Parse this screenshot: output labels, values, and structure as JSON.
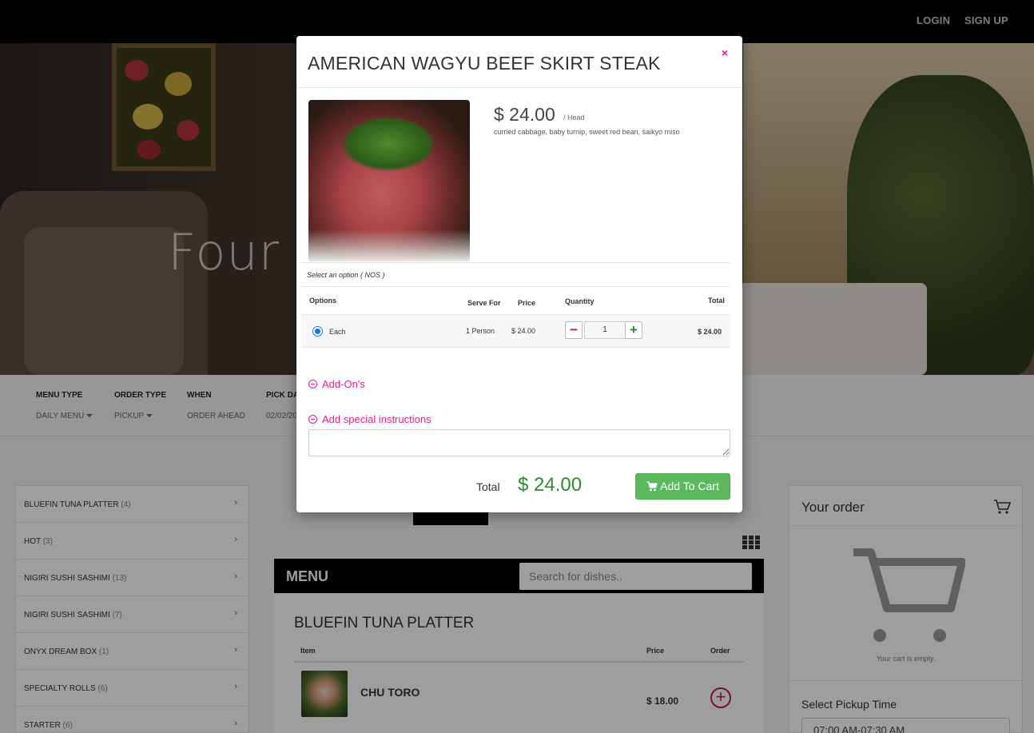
{
  "nav": {
    "login": "LOGIN",
    "signup": "SIGN UP"
  },
  "hero": {
    "title": "Four S                    Culina"
  },
  "filters": [
    {
      "label": "MENU TYPE",
      "value": "DAILY MENU",
      "has_caret": true
    },
    {
      "label": "ORDER TYPE",
      "value": "PICKUP",
      "has_caret": true
    },
    {
      "label": "WHEN",
      "value": "ORDER AHEAD",
      "has_caret": false
    },
    {
      "label": "PICK DA",
      "value": "02/02/20",
      "has_caret": false
    }
  ],
  "categories": [
    {
      "label": "BLUEFIN TUNA PLATTER",
      "count": "(4)"
    },
    {
      "label": "HOT",
      "count": "(3)"
    },
    {
      "label": "NIGIRI SUSHI SASHIMI",
      "count": "(13)"
    },
    {
      "label": "NIGIRI SUSHI SASHIMI",
      "count": "(7)"
    },
    {
      "label": "ONYX DREAM BOX",
      "count": "(1)"
    },
    {
      "label": "SPECIALTY ROLLS",
      "count": "(6)"
    },
    {
      "label": "STARTER",
      "count": "(6)"
    }
  ],
  "menu": {
    "title": "MENU",
    "search_placeholder": "Search for dishes..",
    "section_title": "BLUEFIN TUNA PLATTER",
    "columns": {
      "item": "Item",
      "price": "Price",
      "order": "Order"
    },
    "items": [
      {
        "name": "CHU TORO",
        "price": "$ 18.00"
      }
    ]
  },
  "cart": {
    "title": "Your order",
    "empty_text": "Your cart is empty.",
    "pickup_label": "Select Pickup Time",
    "pickup_value": "07:00 AM-07:30 AM"
  },
  "modal": {
    "title": "AMERICAN WAGYU BEEF SKIRT STEAK",
    "close": "×",
    "price": "$ 24.00",
    "per": "/ Head",
    "description": "curried cabbage, baby turnip, sweet red bean, saikyo miso",
    "option_prompt": "Select an option ( NOS )",
    "columns": {
      "options": "Options",
      "serve_for": "Serve For",
      "price": "Price",
      "quantity": "Quantity",
      "total": "Total"
    },
    "option_row": {
      "name": "Each",
      "serve_for": "1 Person",
      "price": "$ 24.00",
      "quantity": "1",
      "total": "$ 24.00"
    },
    "addons_label": "Add-On's",
    "instructions_label": "Add special instructions",
    "total_label": "Total",
    "total_value": "$ 24.00",
    "add_to_cart": "Add To Cart"
  },
  "colors": {
    "accent_pink": "#e91e8c",
    "green": "#5cb85c",
    "total_green": "#2e8b2e"
  }
}
